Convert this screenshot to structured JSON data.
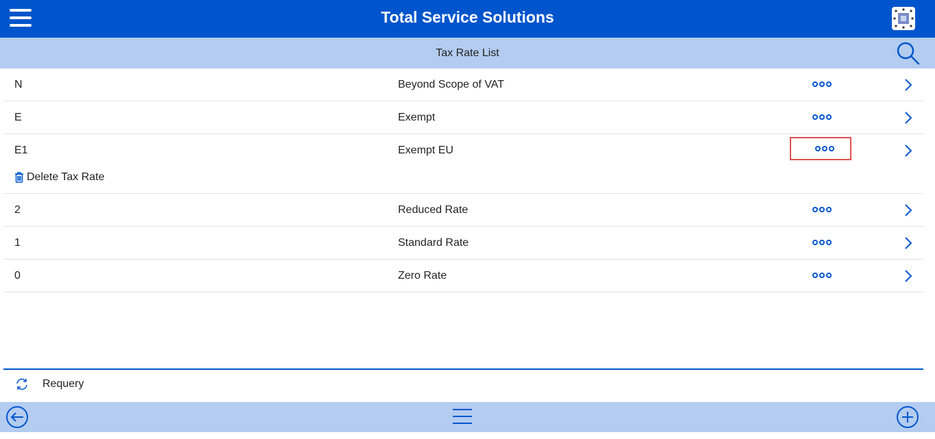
{
  "header": {
    "title": "Total Service Solutions",
    "menu_icon": "hamburger-menu-icon",
    "logo_icon": "app-logo-icon"
  },
  "subheader": {
    "title": "Tax Rate List",
    "search_icon": "search-icon"
  },
  "tax_rates": [
    {
      "code": "N",
      "description": "Beyond Scope of VAT"
    },
    {
      "code": "E",
      "description": "Exempt"
    },
    {
      "code": "E1",
      "description": "Exempt EU",
      "expanded_action": "Delete Tax Rate"
    },
    {
      "code": "2",
      "description": "Reduced Rate"
    },
    {
      "code": "1",
      "description": "Standard Rate"
    },
    {
      "code": "0",
      "description": "Zero Rate"
    }
  ],
  "actions": {
    "requery": "Requery"
  },
  "colors": {
    "primary": "#0055cc",
    "light_bar": "#b3ccf0",
    "highlight": "#e05050"
  }
}
